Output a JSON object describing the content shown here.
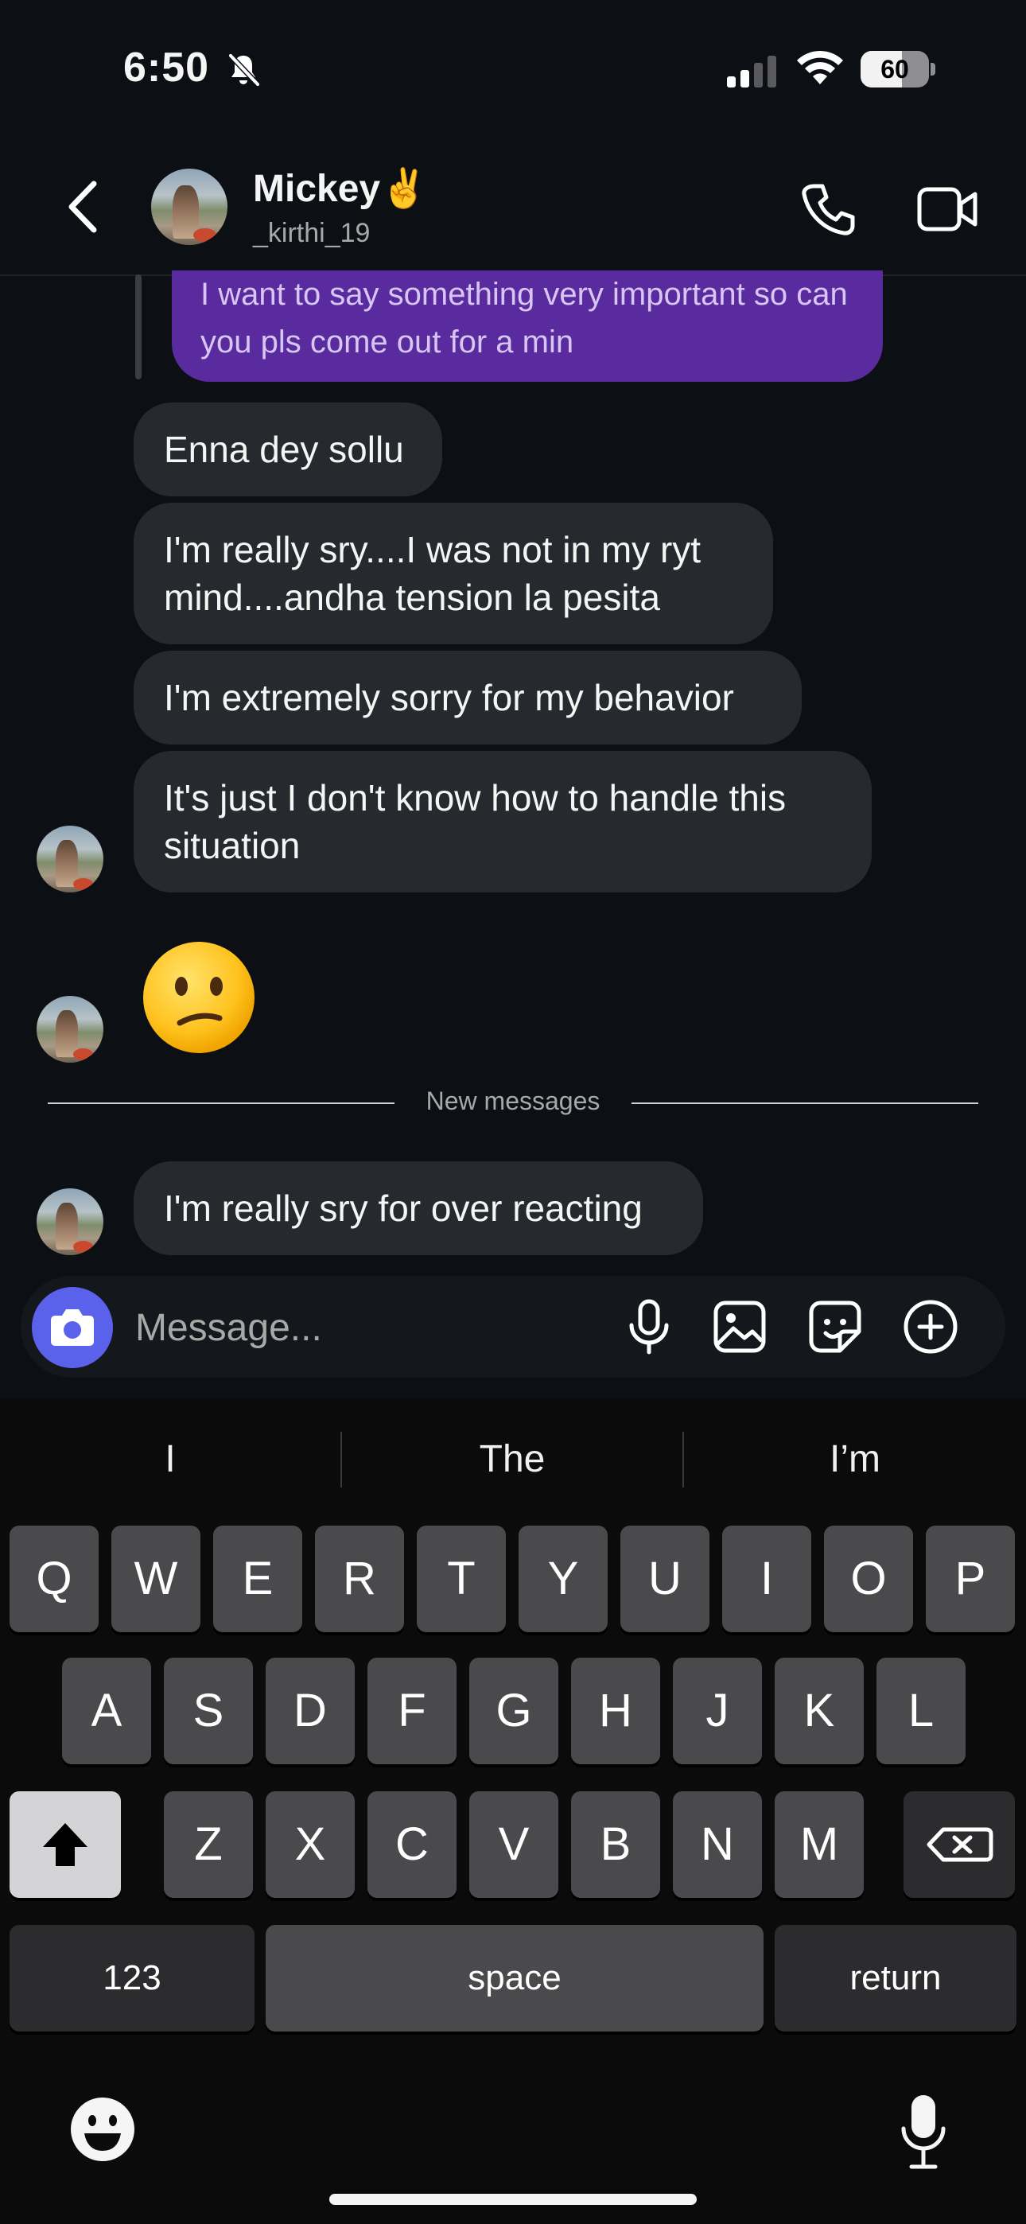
{
  "status_bar": {
    "time": "6:50",
    "battery": "60",
    "battery_level": 0.6
  },
  "header": {
    "name": "Mickey✌️",
    "username": "_kirthi_19"
  },
  "messages": {
    "replied": "I want to say something very important so can you pls come out for a min",
    "m1": "Enna dey sollu",
    "m2": "I'm really sry....I was not in my ryt mind....andha tension la pesita",
    "m3": "I'm extremely sorry for my behavior",
    "m4": "It's just I don't know how to handle this situation",
    "divider": "New messages",
    "m5": "I'm really sry for over reacting"
  },
  "composer": {
    "placeholder": "Message..."
  },
  "keyboard": {
    "suggestions": [
      "I",
      "The",
      "I’m"
    ],
    "row1": [
      "Q",
      "W",
      "E",
      "R",
      "T",
      "Y",
      "U",
      "I",
      "O",
      "P"
    ],
    "row2": [
      "A",
      "S",
      "D",
      "F",
      "G",
      "H",
      "J",
      "K",
      "L"
    ],
    "row3": [
      "Z",
      "X",
      "C",
      "V",
      "B",
      "N",
      "M"
    ],
    "numbers": "123",
    "space": "space",
    "return": "return"
  },
  "colors": {
    "accent": "#5a62ec",
    "sent_bubble": "#5a2b9e",
    "received_bubble": "#26292e",
    "background": "#0c1014"
  }
}
